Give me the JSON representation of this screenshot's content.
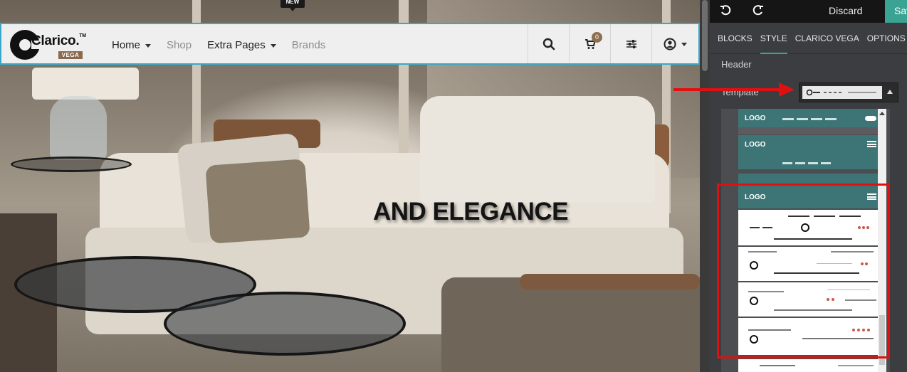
{
  "site": {
    "logo_text": "Clarico.",
    "logo_tm": "TM",
    "logo_sub": "VEGA",
    "nav": [
      {
        "label": "Home",
        "dropdown": true,
        "muted": false
      },
      {
        "label": "Shop",
        "dropdown": false,
        "muted": true
      },
      {
        "label": "Extra Pages",
        "dropdown": true,
        "muted": false
      },
      {
        "label": "Brands",
        "dropdown": false,
        "muted": true
      }
    ],
    "new_badge": "NEW",
    "cart_count": "0",
    "hero_heading": "AND ELEGANCE",
    "accent_color": "#3aa7c9"
  },
  "editor": {
    "discard_label": "Discard",
    "save_label": "Save",
    "tabs": [
      "BLOCKS",
      "STYLE",
      "CLARICO VEGA",
      "OPTIONS"
    ],
    "active_tab": "STYLE",
    "section_title": "Header",
    "template_label": "Template",
    "template_logo_text": "LOGO",
    "accent_color": "#3aa394",
    "highlight_color": "#e01010"
  }
}
